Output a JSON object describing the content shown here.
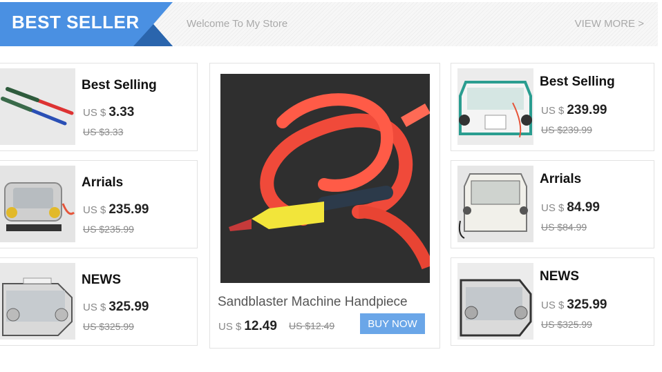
{
  "header": {
    "badge_label": "BEST SELLER",
    "welcome_text": "Welcome To My Store",
    "view_more_label": "VIEW MORE >",
    "accent_color": "#4a90e2"
  },
  "left_products": [
    {
      "title": "Best Selling",
      "currency": "US $",
      "price": "3.33",
      "old_price": "US $3.33",
      "image": "handpiece-pens"
    },
    {
      "title": "Arrials",
      "currency": "US $",
      "price": "235.99",
      "old_price": "US $235.99",
      "image": "sandblaster-double"
    },
    {
      "title": "NEWS",
      "currency": "US $",
      "price": "325.99",
      "old_price": "US $325.99",
      "image": "sandblaster-cabinet"
    }
  ],
  "featured_product": {
    "title": "Sandblaster Machine Handpiece",
    "currency": "US $",
    "price": "12.49",
    "old_price": "US $12.49",
    "buy_label": "BUY NOW",
    "image": "red-hose-handpiece"
  },
  "right_products": [
    {
      "title": "Best Selling",
      "currency": "US $",
      "price": "239.99",
      "old_price": "US $239.99",
      "image": "sandblaster-green"
    },
    {
      "title": "Arrials",
      "currency": "US $",
      "price": "84.99",
      "old_price": "US $84.99",
      "image": "sandblaster-box"
    },
    {
      "title": "NEWS",
      "currency": "US $",
      "price": "325.99",
      "old_price": "US $325.99",
      "image": "sandblaster-cabinet"
    }
  ]
}
